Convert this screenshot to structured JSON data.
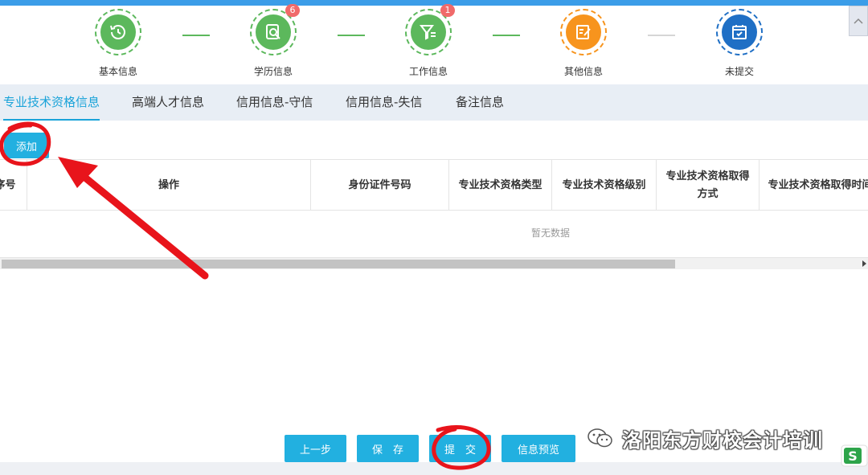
{
  "steps": [
    {
      "label": "基本信息",
      "icon": "clock-history-icon",
      "color": "#5cb85c",
      "badge": ""
    },
    {
      "label": "学历信息",
      "icon": "magnify-document-icon",
      "color": "#5cb85c",
      "badge": "6"
    },
    {
      "label": "工作信息",
      "icon": "filter-icon",
      "color": "#5cb85c",
      "badge": "1"
    },
    {
      "label": "其他信息",
      "icon": "edit-note-icon",
      "color": "#f7941d",
      "badge": ""
    },
    {
      "label": "未提交",
      "icon": "calendar-check-icon",
      "color": "#1f6fc5",
      "badge": ""
    }
  ],
  "tabs": [
    {
      "label": "专业技术资格信息",
      "active": true
    },
    {
      "label": "高端人才信息",
      "active": false
    },
    {
      "label": "信用信息-守信",
      "active": false
    },
    {
      "label": "信用信息-失信",
      "active": false
    },
    {
      "label": "备注信息",
      "active": false
    }
  ],
  "toolbar": {
    "add_label": "添加"
  },
  "table": {
    "columns": [
      "序号",
      "操作",
      "身份证件号码",
      "专业技术资格类型",
      "专业技术资格级别",
      "专业技术资格取得方式",
      "专业技术资格取得时间"
    ],
    "empty_text": "暂无数据"
  },
  "footer": {
    "prev_label": "上一步",
    "save_label": "保　存",
    "submit_label": "提　交",
    "preview_label": "信息预览"
  },
  "watermark": {
    "text": "洛阳东方财校会计培训"
  },
  "colors": {
    "accent": "#22b0e0",
    "done": "#5cb85c",
    "current": "#f7941d",
    "pending": "#1f6fc5",
    "annotation": "#e8141b"
  }
}
